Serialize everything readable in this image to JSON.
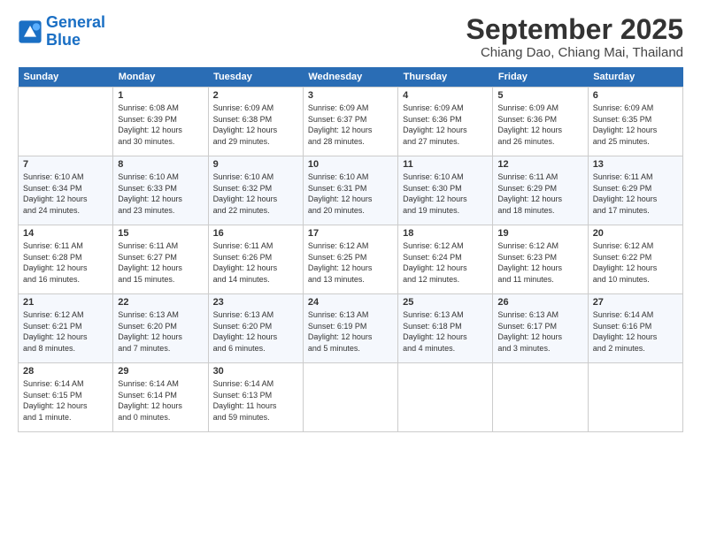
{
  "logo": {
    "line1": "General",
    "line2": "Blue"
  },
  "title": "September 2025",
  "location": "Chiang Dao, Chiang Mai, Thailand",
  "weekdays": [
    "Sunday",
    "Monday",
    "Tuesday",
    "Wednesday",
    "Thursday",
    "Friday",
    "Saturday"
  ],
  "weeks": [
    [
      {
        "day": "",
        "info": ""
      },
      {
        "day": "1",
        "info": "Sunrise: 6:08 AM\nSunset: 6:39 PM\nDaylight: 12 hours\nand 30 minutes."
      },
      {
        "day": "2",
        "info": "Sunrise: 6:09 AM\nSunset: 6:38 PM\nDaylight: 12 hours\nand 29 minutes."
      },
      {
        "day": "3",
        "info": "Sunrise: 6:09 AM\nSunset: 6:37 PM\nDaylight: 12 hours\nand 28 minutes."
      },
      {
        "day": "4",
        "info": "Sunrise: 6:09 AM\nSunset: 6:36 PM\nDaylight: 12 hours\nand 27 minutes."
      },
      {
        "day": "5",
        "info": "Sunrise: 6:09 AM\nSunset: 6:36 PM\nDaylight: 12 hours\nand 26 minutes."
      },
      {
        "day": "6",
        "info": "Sunrise: 6:09 AM\nSunset: 6:35 PM\nDaylight: 12 hours\nand 25 minutes."
      }
    ],
    [
      {
        "day": "7",
        "info": "Sunrise: 6:10 AM\nSunset: 6:34 PM\nDaylight: 12 hours\nand 24 minutes."
      },
      {
        "day": "8",
        "info": "Sunrise: 6:10 AM\nSunset: 6:33 PM\nDaylight: 12 hours\nand 23 minutes."
      },
      {
        "day": "9",
        "info": "Sunrise: 6:10 AM\nSunset: 6:32 PM\nDaylight: 12 hours\nand 22 minutes."
      },
      {
        "day": "10",
        "info": "Sunrise: 6:10 AM\nSunset: 6:31 PM\nDaylight: 12 hours\nand 20 minutes."
      },
      {
        "day": "11",
        "info": "Sunrise: 6:10 AM\nSunset: 6:30 PM\nDaylight: 12 hours\nand 19 minutes."
      },
      {
        "day": "12",
        "info": "Sunrise: 6:11 AM\nSunset: 6:29 PM\nDaylight: 12 hours\nand 18 minutes."
      },
      {
        "day": "13",
        "info": "Sunrise: 6:11 AM\nSunset: 6:29 PM\nDaylight: 12 hours\nand 17 minutes."
      }
    ],
    [
      {
        "day": "14",
        "info": "Sunrise: 6:11 AM\nSunset: 6:28 PM\nDaylight: 12 hours\nand 16 minutes."
      },
      {
        "day": "15",
        "info": "Sunrise: 6:11 AM\nSunset: 6:27 PM\nDaylight: 12 hours\nand 15 minutes."
      },
      {
        "day": "16",
        "info": "Sunrise: 6:11 AM\nSunset: 6:26 PM\nDaylight: 12 hours\nand 14 minutes."
      },
      {
        "day": "17",
        "info": "Sunrise: 6:12 AM\nSunset: 6:25 PM\nDaylight: 12 hours\nand 13 minutes."
      },
      {
        "day": "18",
        "info": "Sunrise: 6:12 AM\nSunset: 6:24 PM\nDaylight: 12 hours\nand 12 minutes."
      },
      {
        "day": "19",
        "info": "Sunrise: 6:12 AM\nSunset: 6:23 PM\nDaylight: 12 hours\nand 11 minutes."
      },
      {
        "day": "20",
        "info": "Sunrise: 6:12 AM\nSunset: 6:22 PM\nDaylight: 12 hours\nand 10 minutes."
      }
    ],
    [
      {
        "day": "21",
        "info": "Sunrise: 6:12 AM\nSunset: 6:21 PM\nDaylight: 12 hours\nand 8 minutes."
      },
      {
        "day": "22",
        "info": "Sunrise: 6:13 AM\nSunset: 6:20 PM\nDaylight: 12 hours\nand 7 minutes."
      },
      {
        "day": "23",
        "info": "Sunrise: 6:13 AM\nSunset: 6:20 PM\nDaylight: 12 hours\nand 6 minutes."
      },
      {
        "day": "24",
        "info": "Sunrise: 6:13 AM\nSunset: 6:19 PM\nDaylight: 12 hours\nand 5 minutes."
      },
      {
        "day": "25",
        "info": "Sunrise: 6:13 AM\nSunset: 6:18 PM\nDaylight: 12 hours\nand 4 minutes."
      },
      {
        "day": "26",
        "info": "Sunrise: 6:13 AM\nSunset: 6:17 PM\nDaylight: 12 hours\nand 3 minutes."
      },
      {
        "day": "27",
        "info": "Sunrise: 6:14 AM\nSunset: 6:16 PM\nDaylight: 12 hours\nand 2 minutes."
      }
    ],
    [
      {
        "day": "28",
        "info": "Sunrise: 6:14 AM\nSunset: 6:15 PM\nDaylight: 12 hours\nand 1 minute."
      },
      {
        "day": "29",
        "info": "Sunrise: 6:14 AM\nSunset: 6:14 PM\nDaylight: 12 hours\nand 0 minutes."
      },
      {
        "day": "30",
        "info": "Sunrise: 6:14 AM\nSunset: 6:13 PM\nDaylight: 11 hours\nand 59 minutes."
      },
      {
        "day": "",
        "info": ""
      },
      {
        "day": "",
        "info": ""
      },
      {
        "day": "",
        "info": ""
      },
      {
        "day": "",
        "info": ""
      }
    ]
  ]
}
